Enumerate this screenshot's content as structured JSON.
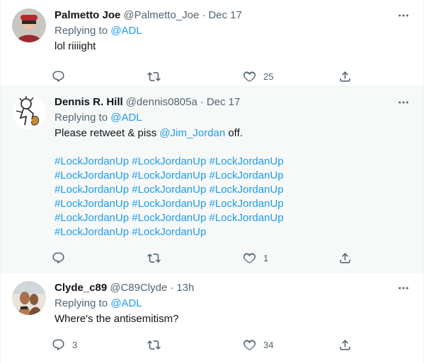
{
  "tweets": [
    {
      "name": "Palmetto Joe",
      "handle": "@Palmetto_Joe",
      "time": "Dec 17",
      "replying_label": "Replying to",
      "replying_to": "@ADL",
      "text": "lol riiiight",
      "replies": "",
      "retweets": "",
      "likes": "25"
    },
    {
      "name": "Dennis R. Hill",
      "handle": "@dennis0805a",
      "time": "Dec 17",
      "replying_label": "Replying to",
      "replying_to": "@ADL",
      "text_before": "Please retweet & piss ",
      "mention": "@Jim_Jordan",
      "text_after": " off.",
      "hashtag_lines": [
        [
          "#LockJordanUp",
          "#LockJordanUp",
          "#LockJordanUp"
        ],
        [
          "#LockJordanUp",
          "#LockJordanUp",
          "#LockJordanUp"
        ],
        [
          "#LockJordanUp",
          "#LockJordanUp",
          "#LockJordanUp"
        ],
        [
          "#LockJordanUp",
          "#LockJordanUp",
          "#LockJordanUp"
        ],
        [
          "#LockJordanUp",
          "#LockJordanUp",
          "#LockJordanUp"
        ],
        [
          "#LockJordanUp",
          "#LockJordanUp"
        ]
      ],
      "replies": "",
      "retweets": "",
      "likes": "1"
    },
    {
      "name": "Clyde_c89",
      "handle": "@C89Clyde",
      "time": "13h",
      "replying_label": "Replying to",
      "replying_to": "@ADL",
      "text": "Where's the antisemitism?",
      "replies": "3",
      "retweets": "",
      "likes": "34"
    }
  ],
  "separator": "·",
  "colors": {
    "link": "#1d9bf0",
    "muted": "#536471",
    "highlight_bg": "#f7f9f9"
  }
}
